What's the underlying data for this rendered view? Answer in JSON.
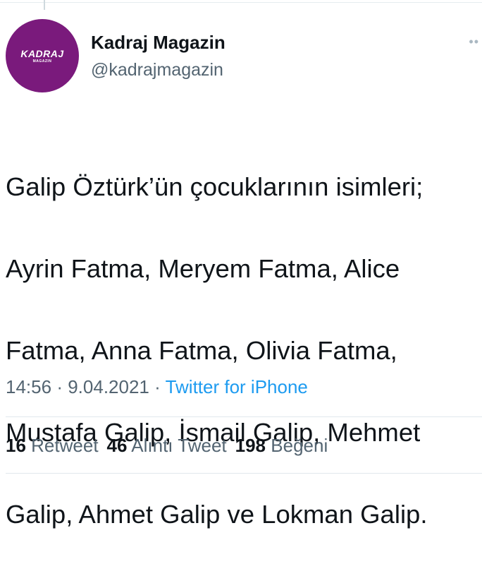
{
  "account": {
    "avatar_text": "KADRAJ",
    "avatar_subtext": "MAGAZIN",
    "display_name": "Kadraj Magazin",
    "handle": "@kadrajmagazin"
  },
  "tweet": {
    "text_lines": [
      "Galip Öztürk’ün çocuklarının isimleri;",
      "Ayrin Fatma, Meryem Fatma, Alice",
      "Fatma, Anna Fatma, Olivia Fatma,",
      "Mustafa Galip, İsmail Galip, Mehmet",
      "Galip, Ahmet Galip ve Lokman Galip."
    ],
    "time": "14:56",
    "date": "9.04.2021",
    "separator": "·",
    "source": "Twitter for iPhone"
  },
  "stats": {
    "retweets_count": "16",
    "retweets_label": "Retweet",
    "quotes_count": "46",
    "quotes_label": "Alıntı Tweet",
    "likes_count": "198",
    "likes_label": "Beğeni"
  },
  "icons": {
    "more": "more-dots-icon"
  },
  "colors": {
    "avatar_bg": "#7a1a7c",
    "link": "#1d9bf0",
    "secondary_text": "#536471"
  }
}
